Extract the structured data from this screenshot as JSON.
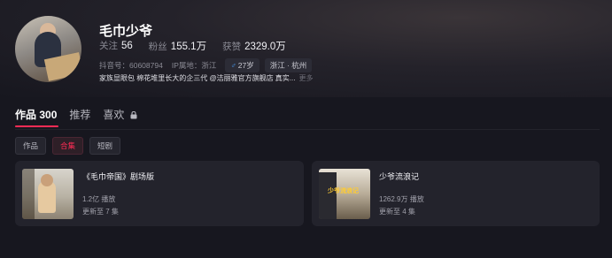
{
  "profile": {
    "name": "毛巾少爷",
    "stats": [
      {
        "label": "关注",
        "value": "56"
      },
      {
        "label": "粉丝",
        "value": "155.1万"
      },
      {
        "label": "获赞",
        "value": "2329.0万"
      }
    ],
    "douyin_id": "抖音号：60608794",
    "ip_location": "IP属地：浙江",
    "gender_age": "27岁",
    "gender_symbol": "♂",
    "region_tag": "浙江 · 杭州",
    "bio": "家族显眼包 棉花堆里长大的企三代 @洁丽雅官方旗舰店 真实...",
    "bio_more": "更多"
  },
  "tabs": [
    {
      "label": "作品",
      "count": "300"
    },
    {
      "label": "推荐"
    },
    {
      "label": "喜欢"
    }
  ],
  "filters": [
    "作品",
    "合集",
    "短剧"
  ],
  "collections": [
    {
      "title": "《毛巾帝国》剧场版",
      "views": "1.2亿 播放",
      "update": "更新至 7 集"
    },
    {
      "title": "少爷流浪记",
      "views": "1262.9万 播放",
      "update": "更新至 4 集",
      "thumb_text": "少爷流浪记"
    }
  ],
  "colors": {
    "accent": "#fe2c55",
    "background": "#17171f",
    "card": "#23232c",
    "male": "#4aa3ff"
  },
  "icons": {
    "lock": "lock-icon",
    "gender": "male-icon"
  }
}
